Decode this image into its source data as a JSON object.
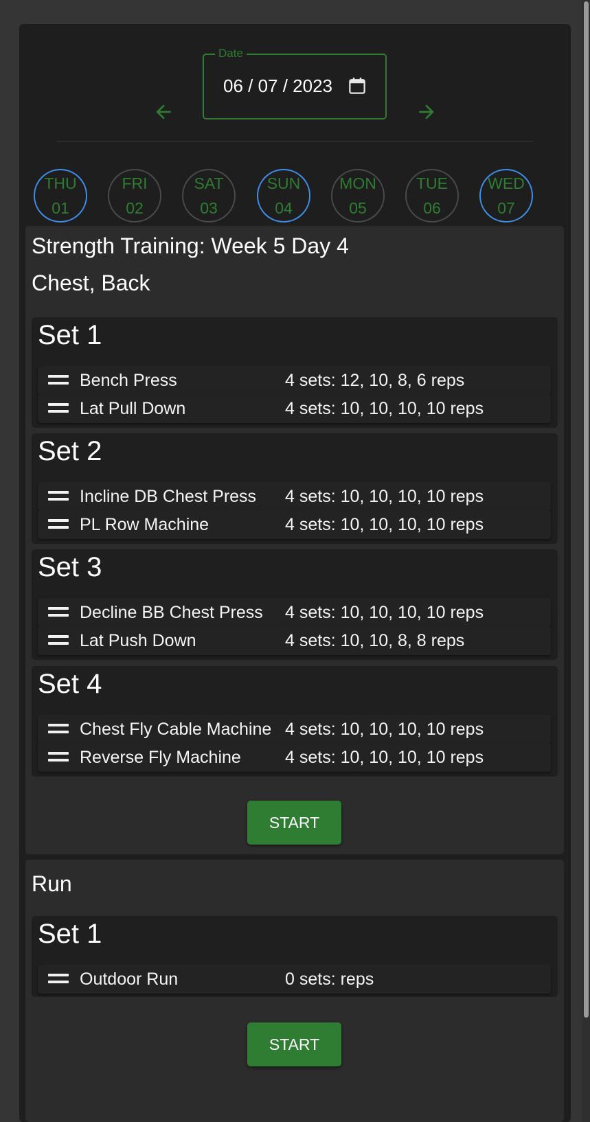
{
  "date_picker": {
    "legend": "Date",
    "value": "06 / 07 / 2023",
    "prev_icon": "arrow-left-icon",
    "next_icon": "arrow-right-icon",
    "calendar_icon": "calendar-icon"
  },
  "week_days": [
    {
      "name": "THU",
      "num": "01",
      "marked": true
    },
    {
      "name": "FRI",
      "num": "02",
      "marked": false
    },
    {
      "name": "SAT",
      "num": "03",
      "marked": false
    },
    {
      "name": "SUN",
      "num": "04",
      "marked": true
    },
    {
      "name": "MON",
      "num": "05",
      "marked": false
    },
    {
      "name": "TUE",
      "num": "06",
      "marked": false
    },
    {
      "name": "WED",
      "num": "07",
      "marked": true
    }
  ],
  "workouts": [
    {
      "title": "Strength Training: Week 5 Day 4",
      "subtitle": "Chest, Back",
      "sets": [
        {
          "title": "Set 1",
          "exercises": [
            {
              "name": "Bench Press",
              "detail": "4 sets: 12, 10, 8, 6 reps"
            },
            {
              "name": "Lat Pull Down",
              "detail": "4 sets: 10, 10, 10, 10 reps"
            }
          ]
        },
        {
          "title": "Set 2",
          "exercises": [
            {
              "name": "Incline DB Chest Press",
              "detail": "4 sets: 10, 10, 10, 10 reps"
            },
            {
              "name": "PL Row Machine",
              "detail": "4 sets: 10, 10, 10, 10 reps"
            }
          ]
        },
        {
          "title": "Set 3",
          "exercises": [
            {
              "name": "Decline BB Chest Press",
              "detail": "4 sets: 10, 10, 10, 10 reps"
            },
            {
              "name": "Lat Push Down",
              "detail": "4 sets: 10, 10, 8, 8 reps"
            }
          ]
        },
        {
          "title": "Set 4",
          "exercises": [
            {
              "name": "Chest Fly Cable Machine",
              "detail": "4 sets: 10, 10, 10, 10 reps"
            },
            {
              "name": "Reverse Fly Machine",
              "detail": "4 sets: 10, 10, 10, 10 reps"
            }
          ]
        }
      ],
      "start_label": "START"
    },
    {
      "title": "Run",
      "sets": [
        {
          "title": "Set 1",
          "exercises": [
            {
              "name": "Outdoor Run",
              "detail": "0 sets: reps"
            }
          ]
        }
      ],
      "start_label": "START"
    }
  ],
  "colors": {
    "accent_green": "#2e7d32",
    "marked_day_border": "#3f8ee8",
    "card_background": "#2c2c2c",
    "page_background": "#1e1e1e"
  }
}
